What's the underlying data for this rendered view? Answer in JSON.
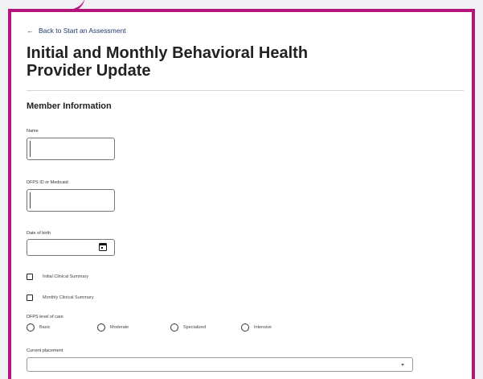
{
  "nav": {
    "back_label": "Back to Start an Assessment"
  },
  "page": {
    "title": "Initial and Monthly Behavioral Health Provider Update"
  },
  "member_section": {
    "title": "Member Information",
    "name_label": "Name",
    "name_value": "",
    "id_label": "DFPS ID or Medicaid",
    "id_value": "",
    "dob_label": "Date of birth",
    "dob_value": ""
  },
  "summaries": {
    "initial": {
      "label": "Initial Clinical Summary",
      "checked": false
    },
    "monthly": {
      "label": "Monthly Clinical Summary",
      "checked": false
    }
  },
  "level_of_care": {
    "label": "DFPS level of care",
    "options": [
      "Basic",
      "Moderate",
      "Specialized",
      "Intensive"
    ],
    "selected": ""
  },
  "placement": {
    "label": "Current placement",
    "value": ""
  },
  "colors": {
    "accent_border": "#b4157a",
    "link": "#1f3a6b"
  }
}
